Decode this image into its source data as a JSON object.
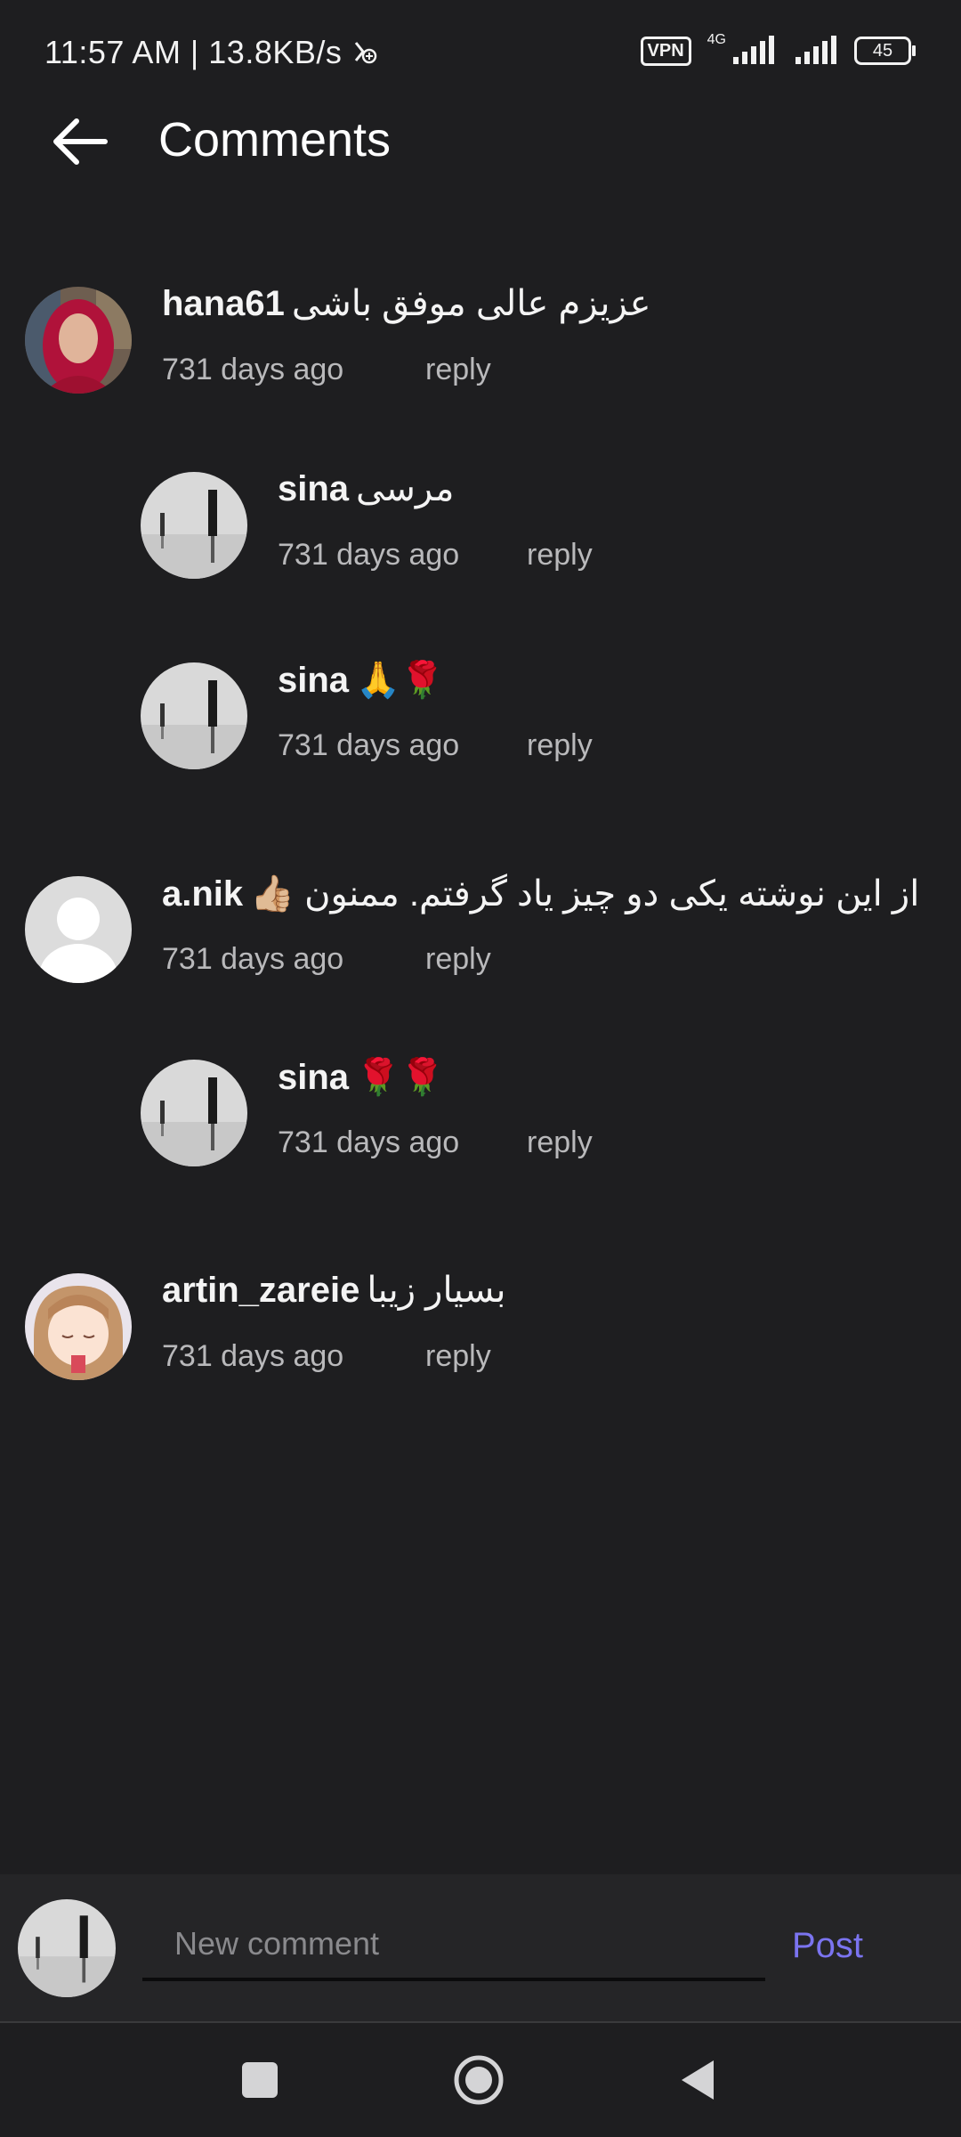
{
  "status_bar": {
    "time_speed": "11:57 AM | 13.8KB/s",
    "vpn": "VPN",
    "network": "4G",
    "battery": "45"
  },
  "header": {
    "back_icon": "arrow-left-icon",
    "title": "Comments"
  },
  "comments": [
    {
      "user": "hana61",
      "text": "عزیزم عالی موفق باشی",
      "time": "731 days ago",
      "reply": "reply"
    },
    {
      "user": "sina",
      "text": "مرسی",
      "time": "731 days ago",
      "reply": "reply"
    },
    {
      "user": "sina",
      "text": "🙏🌹",
      "time": "731 days ago",
      "reply": "reply"
    },
    {
      "user": "a.nik",
      "text": "👍🏼 از این نوشته یکی دو چیز یاد گرفتم. ممنون",
      "time": "731 days ago",
      "reply": "reply"
    },
    {
      "user": "sina",
      "text": "🌹🌹",
      "time": "731 days ago",
      "reply": "reply"
    },
    {
      "user": "artin_zareie",
      "text": "بسیار زیبا",
      "time": "731 days ago",
      "reply": "reply"
    }
  ],
  "composer": {
    "placeholder": "New comment",
    "post_label": "Post"
  },
  "nav": {
    "icons": [
      "recents-square-icon",
      "home-circle-icon",
      "back-triangle-icon"
    ]
  },
  "colors": {
    "background": "#1e1e20",
    "composer_bg": "#252527",
    "accent": "#7b74f0",
    "meta_text": "#b9b9bb"
  }
}
